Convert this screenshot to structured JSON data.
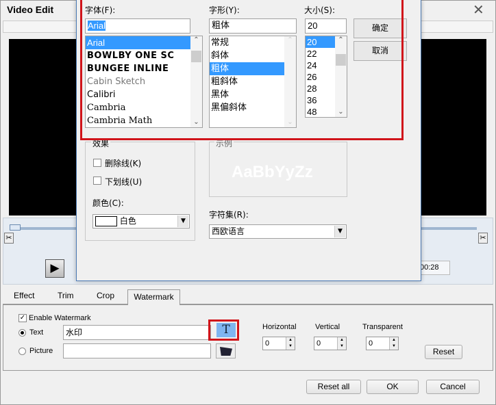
{
  "window": {
    "title": "Video Edit",
    "close": "✕"
  },
  "player": {
    "time": "00:28",
    "play": "▶"
  },
  "font_dialog": {
    "font_label": "字体(F):",
    "font_value": "Arial",
    "fonts": [
      "Arial",
      "BOWLBY ONE SC",
      "BUNGEE INLINE",
      "Cabin Sketch",
      "Calibri",
      "Cambria",
      "Cambria Math"
    ],
    "style_label": "字形(Y):",
    "style_value": "粗体",
    "styles": [
      "常规",
      "斜体",
      "粗体",
      "粗斜体",
      "黑体",
      "黑偏斜体"
    ],
    "size_label": "大小(S):",
    "size_value": "20",
    "sizes": [
      "20",
      "22",
      "24",
      "26",
      "28",
      "36",
      "48"
    ],
    "ok": "确定",
    "cancel": "取消",
    "effects_label": "效果",
    "strike": "删除线(K)",
    "underline": "下划线(U)",
    "color_label": "颜色(C):",
    "color_value": "白色",
    "sample_label": "示例",
    "sample_text": "AaBbYyZz",
    "charset_label": "字符集(R):",
    "charset_value": "西欧语言"
  },
  "tabs": [
    "Effect",
    "Trim",
    "Crop",
    "Watermark"
  ],
  "watermark": {
    "enable": "Enable Watermark",
    "text_label": "Text",
    "text_value": "水印",
    "picture_label": "Picture",
    "font_button": "T",
    "horizontal": "Horizontal",
    "vertical": "Vertical",
    "transparent": "Transparent",
    "h_value": "0",
    "v_value": "0",
    "t_value": "0",
    "reset": "Reset"
  },
  "footer": {
    "reset_all": "Reset all",
    "ok": "OK",
    "cancel": "Cancel"
  },
  "colors": {
    "highlight": "#d0141a",
    "selection": "#3399ff"
  }
}
